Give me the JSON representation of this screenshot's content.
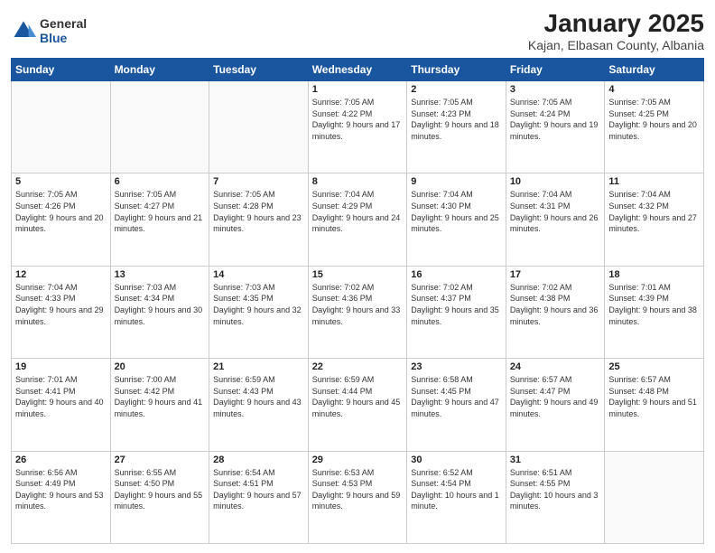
{
  "header": {
    "logo_general": "General",
    "logo_blue": "Blue",
    "title": "January 2025",
    "subtitle": "Kajan, Elbasan County, Albania"
  },
  "weekdays": [
    "Sunday",
    "Monday",
    "Tuesday",
    "Wednesday",
    "Thursday",
    "Friday",
    "Saturday"
  ],
  "weeks": [
    [
      {
        "day": "",
        "info": ""
      },
      {
        "day": "",
        "info": ""
      },
      {
        "day": "",
        "info": ""
      },
      {
        "day": "1",
        "info": "Sunrise: 7:05 AM\nSunset: 4:22 PM\nDaylight: 9 hours and 17 minutes."
      },
      {
        "day": "2",
        "info": "Sunrise: 7:05 AM\nSunset: 4:23 PM\nDaylight: 9 hours and 18 minutes."
      },
      {
        "day": "3",
        "info": "Sunrise: 7:05 AM\nSunset: 4:24 PM\nDaylight: 9 hours and 19 minutes."
      },
      {
        "day": "4",
        "info": "Sunrise: 7:05 AM\nSunset: 4:25 PM\nDaylight: 9 hours and 20 minutes."
      }
    ],
    [
      {
        "day": "5",
        "info": "Sunrise: 7:05 AM\nSunset: 4:26 PM\nDaylight: 9 hours and 20 minutes."
      },
      {
        "day": "6",
        "info": "Sunrise: 7:05 AM\nSunset: 4:27 PM\nDaylight: 9 hours and 21 minutes."
      },
      {
        "day": "7",
        "info": "Sunrise: 7:05 AM\nSunset: 4:28 PM\nDaylight: 9 hours and 23 minutes."
      },
      {
        "day": "8",
        "info": "Sunrise: 7:04 AM\nSunset: 4:29 PM\nDaylight: 9 hours and 24 minutes."
      },
      {
        "day": "9",
        "info": "Sunrise: 7:04 AM\nSunset: 4:30 PM\nDaylight: 9 hours and 25 minutes."
      },
      {
        "day": "10",
        "info": "Sunrise: 7:04 AM\nSunset: 4:31 PM\nDaylight: 9 hours and 26 minutes."
      },
      {
        "day": "11",
        "info": "Sunrise: 7:04 AM\nSunset: 4:32 PM\nDaylight: 9 hours and 27 minutes."
      }
    ],
    [
      {
        "day": "12",
        "info": "Sunrise: 7:04 AM\nSunset: 4:33 PM\nDaylight: 9 hours and 29 minutes."
      },
      {
        "day": "13",
        "info": "Sunrise: 7:03 AM\nSunset: 4:34 PM\nDaylight: 9 hours and 30 minutes."
      },
      {
        "day": "14",
        "info": "Sunrise: 7:03 AM\nSunset: 4:35 PM\nDaylight: 9 hours and 32 minutes."
      },
      {
        "day": "15",
        "info": "Sunrise: 7:02 AM\nSunset: 4:36 PM\nDaylight: 9 hours and 33 minutes."
      },
      {
        "day": "16",
        "info": "Sunrise: 7:02 AM\nSunset: 4:37 PM\nDaylight: 9 hours and 35 minutes."
      },
      {
        "day": "17",
        "info": "Sunrise: 7:02 AM\nSunset: 4:38 PM\nDaylight: 9 hours and 36 minutes."
      },
      {
        "day": "18",
        "info": "Sunrise: 7:01 AM\nSunset: 4:39 PM\nDaylight: 9 hours and 38 minutes."
      }
    ],
    [
      {
        "day": "19",
        "info": "Sunrise: 7:01 AM\nSunset: 4:41 PM\nDaylight: 9 hours and 40 minutes."
      },
      {
        "day": "20",
        "info": "Sunrise: 7:00 AM\nSunset: 4:42 PM\nDaylight: 9 hours and 41 minutes."
      },
      {
        "day": "21",
        "info": "Sunrise: 6:59 AM\nSunset: 4:43 PM\nDaylight: 9 hours and 43 minutes."
      },
      {
        "day": "22",
        "info": "Sunrise: 6:59 AM\nSunset: 4:44 PM\nDaylight: 9 hours and 45 minutes."
      },
      {
        "day": "23",
        "info": "Sunrise: 6:58 AM\nSunset: 4:45 PM\nDaylight: 9 hours and 47 minutes."
      },
      {
        "day": "24",
        "info": "Sunrise: 6:57 AM\nSunset: 4:47 PM\nDaylight: 9 hours and 49 minutes."
      },
      {
        "day": "25",
        "info": "Sunrise: 6:57 AM\nSunset: 4:48 PM\nDaylight: 9 hours and 51 minutes."
      }
    ],
    [
      {
        "day": "26",
        "info": "Sunrise: 6:56 AM\nSunset: 4:49 PM\nDaylight: 9 hours and 53 minutes."
      },
      {
        "day": "27",
        "info": "Sunrise: 6:55 AM\nSunset: 4:50 PM\nDaylight: 9 hours and 55 minutes."
      },
      {
        "day": "28",
        "info": "Sunrise: 6:54 AM\nSunset: 4:51 PM\nDaylight: 9 hours and 57 minutes."
      },
      {
        "day": "29",
        "info": "Sunrise: 6:53 AM\nSunset: 4:53 PM\nDaylight: 9 hours and 59 minutes."
      },
      {
        "day": "30",
        "info": "Sunrise: 6:52 AM\nSunset: 4:54 PM\nDaylight: 10 hours and 1 minute."
      },
      {
        "day": "31",
        "info": "Sunrise: 6:51 AM\nSunset: 4:55 PM\nDaylight: 10 hours and 3 minutes."
      },
      {
        "day": "",
        "info": ""
      }
    ]
  ]
}
